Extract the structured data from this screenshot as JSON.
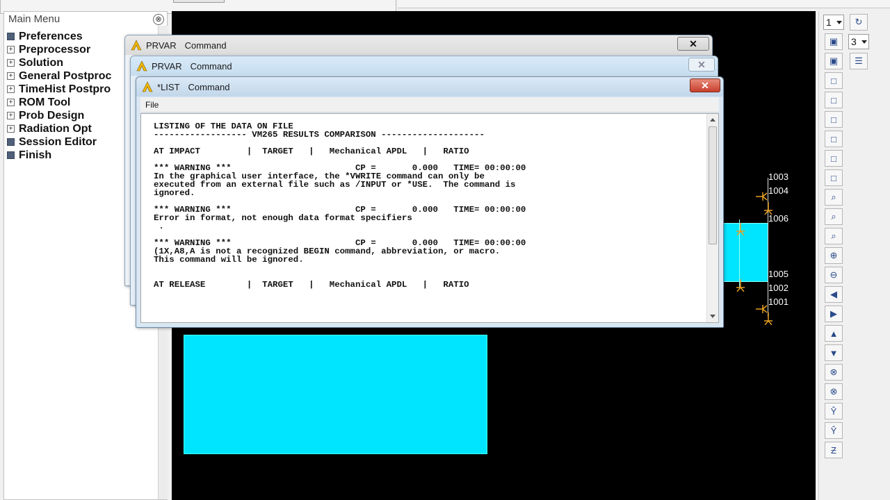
{
  "main_menu": {
    "title": "Main Menu",
    "items": [
      {
        "label": "Preferences",
        "mark": "square"
      },
      {
        "label": "Preprocessor",
        "mark": "plus"
      },
      {
        "label": "Solution",
        "mark": "plus"
      },
      {
        "label": "General Postproc",
        "mark": "plus"
      },
      {
        "label": "TimeHist Postpro",
        "mark": "plus"
      },
      {
        "label": "ROM Tool",
        "mark": "plus"
      },
      {
        "label": "Prob Design",
        "mark": "plus"
      },
      {
        "label": "Radiation Opt",
        "mark": "plus"
      },
      {
        "label": "Session Editor",
        "mark": "square"
      },
      {
        "label": "Finish",
        "mark": "square"
      }
    ]
  },
  "dialogs": [
    {
      "title": "PRVAR",
      "subtitle": "Command"
    },
    {
      "title": "PRVAR",
      "subtitle": "Command"
    },
    {
      "title": "*LIST",
      "subtitle": "Command",
      "menu": "File"
    }
  ],
  "listing": {
    "lines": [
      "LISTING OF THE DATA ON FILE",
      "------------------ VM265 RESULTS COMPARISON --------------------",
      "",
      "AT IMPACT         |  TARGET   |   Mechanical APDL   |   RATIO",
      "",
      "*** WARNING ***                        CP =       0.000   TIME= 00:00:00",
      "In the graphical user interface, the *VWRITE command can only be",
      "executed from an external file such as /INPUT or *USE.  The command is",
      "ignored.",
      "",
      "*** WARNING ***                        CP =       0.000   TIME= 00:00:00",
      "Error in format, not enough data format specifiers",
      " .",
      "",
      "*** WARNING ***                        CP =       0.000   TIME= 00:00:00",
      "(1X,A8,A is not a recognized BEGIN command, abbreviation, or macro.",
      "This command will be ignored.",
      "",
      "",
      "AT RELEASE        |  TARGET   |   Mechanical APDL   |   RATIO"
    ]
  },
  "graphics": {
    "node_labels": [
      "1003",
      "1004",
      "1006",
      "1005",
      "1002",
      "1001"
    ],
    "colors": {
      "background": "#000000",
      "element": "#00e5ff",
      "constraint": "#e8a020"
    }
  },
  "toolbar": {
    "window_select": "1",
    "view_select": "3",
    "icons": [
      "reset-view-icon",
      "iso-view-icon",
      "oblique-view-icon",
      "front-view-icon",
      "back-view-icon",
      "top-view-icon",
      "bottom-view-icon",
      "left-view-icon",
      "right-view-icon",
      "zoom-icon",
      "box-zoom-icon",
      "win-zoom-icon",
      "zoom-in-icon",
      "zoom-out-icon",
      "pan-left-icon",
      "pan-right-icon",
      "pan-up-icon",
      "pan-down-icon",
      "rotate-x-plus-icon",
      "rotate-x-minus-icon",
      "rotate-y-plus-icon",
      "rotate-y-minus-icon",
      "rotate-z-plus-icon",
      "dynamic-mode-icon"
    ]
  }
}
